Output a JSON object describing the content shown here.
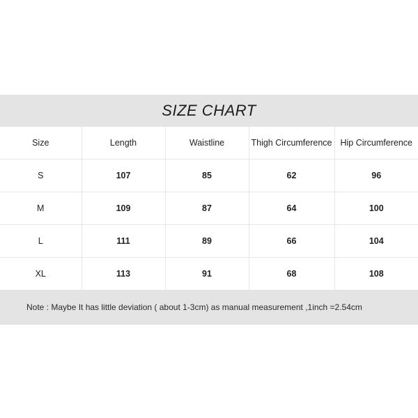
{
  "chart": {
    "title": "SIZE CHART",
    "columns": [
      "Size",
      "Length",
      "Waistline",
      "Thigh Circumference",
      "Hip Circumference"
    ],
    "rows": [
      {
        "size": "S",
        "length": "107",
        "waistline": "85",
        "thigh": "62",
        "hip": "96"
      },
      {
        "size": "M",
        "length": "109",
        "waistline": "87",
        "thigh": "64",
        "hip": "100"
      },
      {
        "size": "L",
        "length": "111",
        "waistline": "89",
        "thigh": "66",
        "hip": "104"
      },
      {
        "size": "XL",
        "length": "113",
        "waistline": "91",
        "thigh": "68",
        "hip": "108"
      }
    ],
    "note": "Note : Maybe It has little deviation ( about 1-3cm) as manual measurement ,1inch =2.54cm",
    "colors": {
      "band_background": "#e4e4e4",
      "table_background": "#ffffff",
      "grid_line": "#e6e6e6",
      "text": "#1f1f1f",
      "page_background": "#ffffff"
    }
  }
}
